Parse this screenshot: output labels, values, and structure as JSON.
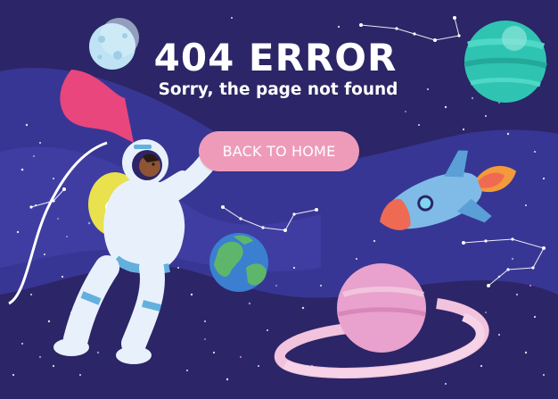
{
  "error_page": {
    "title": "404  ERROR",
    "subtitle": "Sorry, the page not found",
    "back_button_label": "BACK TO HOME"
  },
  "colors": {
    "background": "#2c2567",
    "nebula": "#3d3c9f",
    "button": "#ee9bb9",
    "text": "#ffffff"
  },
  "illustrations": [
    "astronaut-illustration",
    "rocket-illustration",
    "ringed-planet-illustration",
    "earth-planet-illustration",
    "moon-illustration",
    "teal-planet-illustration",
    "constellations"
  ]
}
